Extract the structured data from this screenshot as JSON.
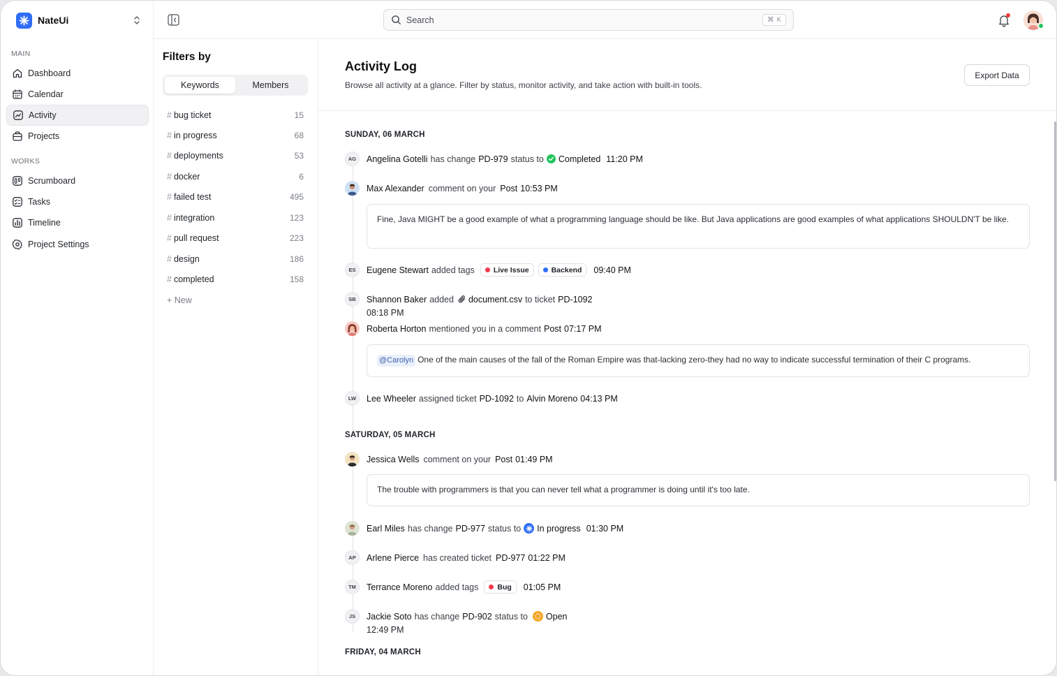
{
  "app": {
    "name": "NateUi"
  },
  "sidebar": {
    "main_label": "MAIN",
    "works_label": "WORKS",
    "main_items": [
      {
        "label": "Dashboard",
        "icon": "home-icon"
      },
      {
        "label": "Calendar",
        "icon": "calendar-icon"
      },
      {
        "label": "Activity",
        "icon": "activity-icon",
        "active": true
      },
      {
        "label": "Projects",
        "icon": "briefcase-icon"
      }
    ],
    "works_items": [
      {
        "label": "Scrumboard",
        "icon": "kanban-icon"
      },
      {
        "label": "Tasks",
        "icon": "tasks-icon"
      },
      {
        "label": "Timeline",
        "icon": "chart-icon"
      },
      {
        "label": "Project Settings",
        "icon": "gear-icon"
      }
    ]
  },
  "topbar": {
    "search_placeholder": "Search",
    "shortcut_symbol": "⌘",
    "shortcut_key": "K"
  },
  "filters": {
    "title": "Filters by",
    "tabs": [
      "Keywords",
      "Members"
    ],
    "tags": [
      {
        "name": "bug ticket",
        "count": "15"
      },
      {
        "name": "in progress",
        "count": "68"
      },
      {
        "name": "deployments",
        "count": "53"
      },
      {
        "name": "docker",
        "count": "6"
      },
      {
        "name": "failed test",
        "count": "495"
      },
      {
        "name": "integration",
        "count": "123"
      },
      {
        "name": "pull request",
        "count": "223"
      },
      {
        "name": "design",
        "count": "186"
      },
      {
        "name": "completed",
        "count": "158"
      }
    ],
    "new_label": "+ New"
  },
  "main": {
    "title": "Activity Log",
    "subtitle": "Browse all activity at a glance. Filter by status, monitor activity, and take action with built-in tools.",
    "export_label": "Export Data"
  },
  "days": [
    {
      "label": "SUNDAY, 06 MARCH"
    },
    {
      "label": "SATURDAY, 05 MARCH"
    },
    {
      "label": "FRIDAY, 04 MARCH"
    }
  ],
  "events": {
    "e1": {
      "initials": "AG",
      "name": "Angelina Gotelli",
      "action": "has change",
      "ticket": "PD-979",
      "action2": "status to",
      "status": "Completed",
      "time": "11:20 PM"
    },
    "e2": {
      "name": "Max Alexander",
      "action": "comment on your",
      "target": "Post",
      "time": "10:53 PM",
      "comment": "Fine, Java MIGHT be a good example of what a programming language should be like. But Java applications are good examples of what applications SHOULDN'T be like."
    },
    "e3": {
      "initials": "ES",
      "name": "Eugene Stewart",
      "action": "added tags",
      "tag1": "Live Issue",
      "tag2": "Backend",
      "time": "09:40 PM"
    },
    "e4": {
      "initials": "SB",
      "name": "Shannon Baker",
      "action": "added",
      "file": "document.csv",
      "action2": "to ticket",
      "ticket": "PD-1092",
      "time": "08:18 PM"
    },
    "e5": {
      "name": "Roberta Horton",
      "action": "mentioned you in a comment",
      "target": "Post",
      "time": "07:17 PM",
      "mention": "@Carolyn",
      "comment": "One of the main causes of the fall of the Roman Empire was that-lacking zero-they had no way to indicate successful termination of their C programs."
    },
    "e6": {
      "initials": "LW",
      "name": "Lee Wheeler",
      "action": "assigned ticket",
      "ticket": "PD-1092",
      "action2": "to",
      "assignee": "Alvin Moreno",
      "time": "04:13 PM"
    },
    "e7": {
      "name": "Jessica Wells",
      "action": "comment on your",
      "target": "Post",
      "time": "01:49 PM",
      "comment": "The trouble with programmers is that you can never tell what a programmer is doing until it's too late."
    },
    "e8": {
      "name": "Earl Miles",
      "action": "has change",
      "ticket": "PD-977",
      "action2": "status to",
      "status": "In progress",
      "time": "01:30 PM"
    },
    "e9": {
      "initials": "AP",
      "name": "Arlene Pierce",
      "action": "has created ticket",
      "ticket": "PD-977",
      "time": "01:22 PM"
    },
    "e10": {
      "initials": "TM",
      "name": "Terrance Moreno",
      "action": "added tags",
      "tag1": "Bug",
      "time": "01:05 PM"
    },
    "e11": {
      "initials": "JS",
      "name": "Jackie Soto",
      "action": "has change",
      "ticket": "PD-902",
      "action2": "status to",
      "status": "Open",
      "time": "12:49 PM"
    }
  },
  "colors": {
    "accent": "#2f6df6",
    "completed": "#22c55e",
    "live_issue": "#ef3a4a",
    "backend": "#2f6df6",
    "bug": "#ef3a4a",
    "open": "#f5a524"
  }
}
